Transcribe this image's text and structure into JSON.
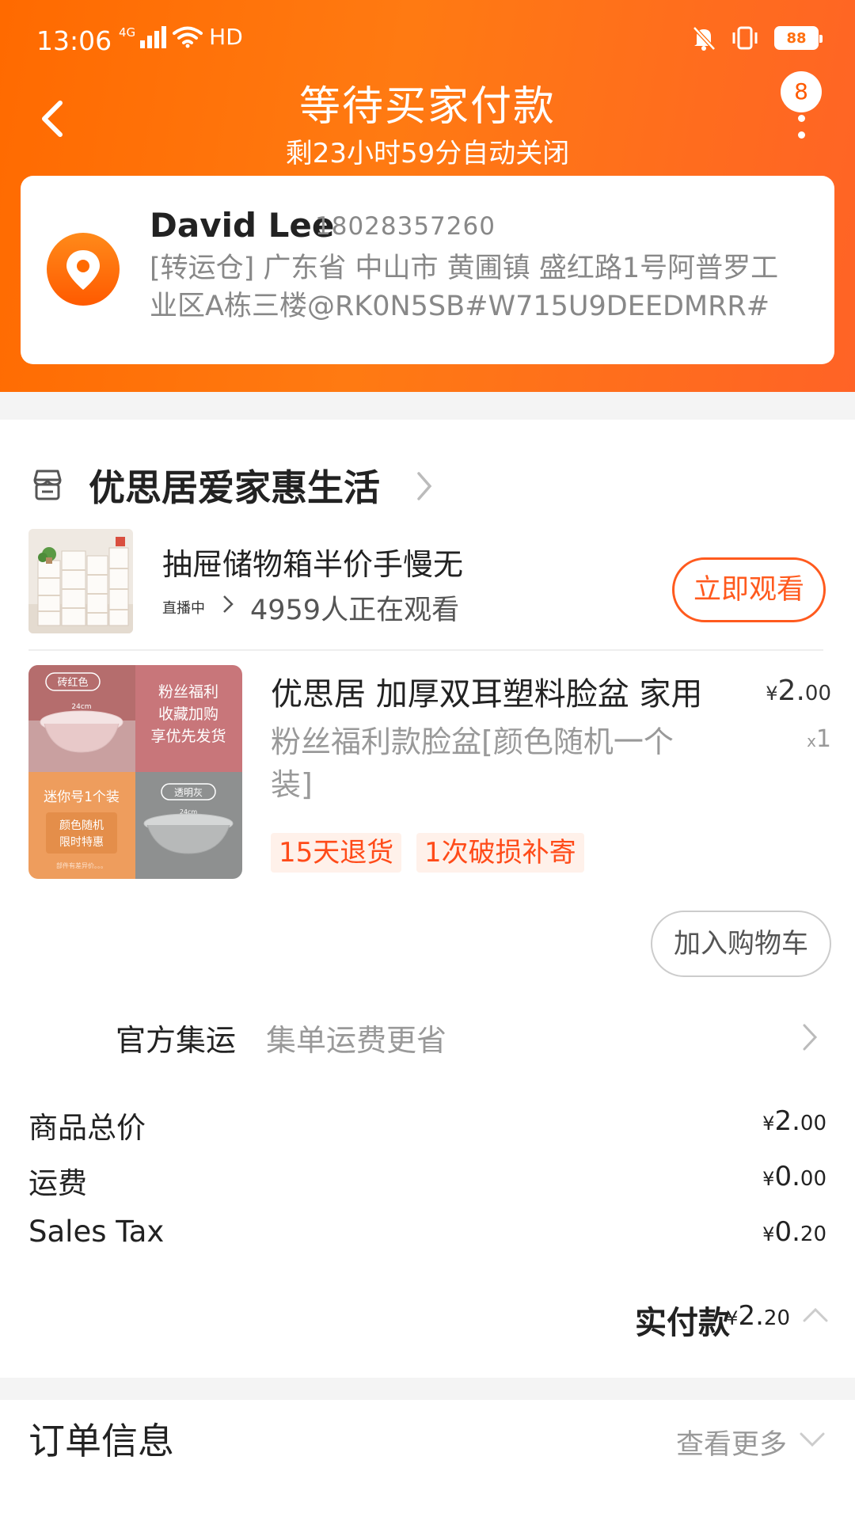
{
  "status_bar": {
    "time": "13:06",
    "network": "4G",
    "hd": "HD",
    "battery": "88"
  },
  "header": {
    "title": "等待买家付款",
    "subtitle": "剩23小时59分自动关闭",
    "message_badge": "8"
  },
  "address": {
    "name": "David Lee",
    "phone": "18028357260",
    "line1": "[转运仓] 广东省 中山市 黄圃镇 盛红路1号阿普罗工",
    "line2": "业区A栋三楼@RK0N5SB#W715U9DEEDMRR#"
  },
  "store": {
    "name": "优思居爱家惠生活"
  },
  "live": {
    "title": "抽屉储物箱半价手慢无",
    "tag": "直播中",
    "viewers": "4959人正在观看",
    "watch_button": "立即观看"
  },
  "product": {
    "title": "优思居 加厚双耳塑料脸盆 家用",
    "spec_line1": "粉丝福利款脸盆[颜色随机一个",
    "spec_line2": "装]",
    "price_yen": "¥",
    "price_int": "2.",
    "price_dec": "00",
    "qty_x": "x",
    "qty": "1",
    "tags": [
      "15天退货",
      "1次破损补寄"
    ],
    "image_labels": {
      "tl": "砖红色",
      "tl_size": "24cm",
      "tr": "粉丝福利\n收藏加购\n享优先发货",
      "bl": "迷你号1个装",
      "bl_box": "颜色随机\n限时特惠",
      "bl_small": "部件有差异价。。。",
      "br": "透明灰",
      "br_size": "24cm"
    }
  },
  "cart_button": "加入购物车",
  "shipping": {
    "label": "官方集运",
    "value": "集单运费更省"
  },
  "summary": [
    {
      "label": "商品总价",
      "yen": "¥",
      "int": "2.",
      "dec": "00"
    },
    {
      "label": "运费",
      "yen": "¥",
      "int": "0.",
      "dec": "00"
    },
    {
      "label": "Sales Tax",
      "yen": "¥",
      "int": "0.",
      "dec": "20"
    }
  ],
  "paid": {
    "label": "实付款",
    "yen": "¥",
    "int": "2.",
    "dec": "20"
  },
  "order_info": {
    "title": "订单信息",
    "more": "查看更多"
  },
  "colors": {
    "brand_orange": "#ff6a00",
    "accent_red": "#ff4b19"
  },
  "icons": {
    "back": "back-icon",
    "more": "more-dots-icon",
    "location": "location-pin-icon",
    "store": "store-icon",
    "chevron": "chevron-right-icon",
    "collapse": "chevron-up-icon",
    "expand": "chevron-down-icon"
  }
}
